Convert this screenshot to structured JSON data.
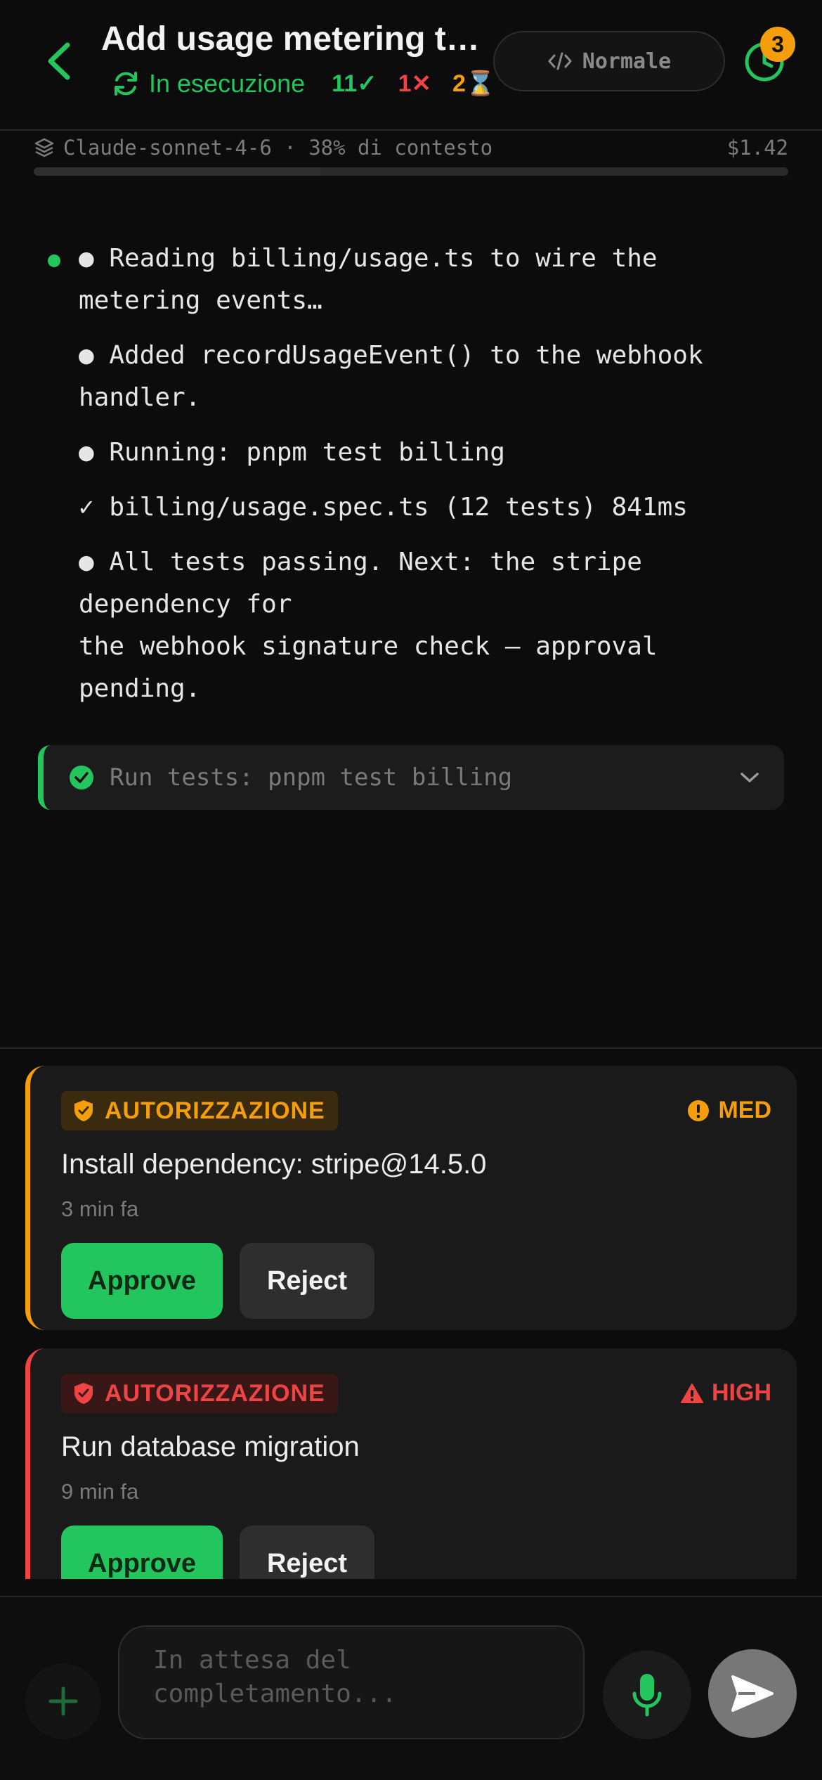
{
  "header": {
    "title": "Add usage metering to…",
    "status_label": "In esecuzione",
    "count_ok": "11✓",
    "count_err": "1✕",
    "count_wait": "2⌛",
    "mode_label": "Normale",
    "history_badge": "3"
  },
  "model_bar": {
    "text": "Claude-sonnet-4-6 · 38% di contesto",
    "cost": "$1.42",
    "context_fraction": 0.38
  },
  "log": {
    "lines": [
      "● Reading billing/usage.ts to wire the\nmetering events…",
      "● Added recordUsageEvent() to the webhook\nhandler.",
      "● Running: pnpm test billing",
      "✓ billing/usage.spec.ts (12 tests) 841ms",
      "● All tests passing. Next: the stripe\ndependency for\nthe webhook signature check — approval\npending."
    ]
  },
  "tool": {
    "label": "Run tests: pnpm test billing"
  },
  "approvals": [
    {
      "tag": "AUTORIZZAZIONE",
      "risk": "MED",
      "title": "Install dependency: stripe@14.5.0",
      "time": "3 min fa",
      "approve": "Approve",
      "reject": "Reject",
      "color": "#f59e0b"
    },
    {
      "tag": "AUTORIZZAZIONE",
      "risk": "HIGH",
      "title": "Run database migration",
      "time": "9 min fa",
      "approve": "Approve",
      "reject": "Reject",
      "color": "#ef4444"
    }
  ],
  "composer": {
    "placeholder": "In attesa del\ncompletamento..."
  },
  "colors": {
    "accent_green": "#22c55e",
    "warning": "#f59e0b",
    "danger": "#ef4444",
    "background": "#0c0c0c"
  }
}
